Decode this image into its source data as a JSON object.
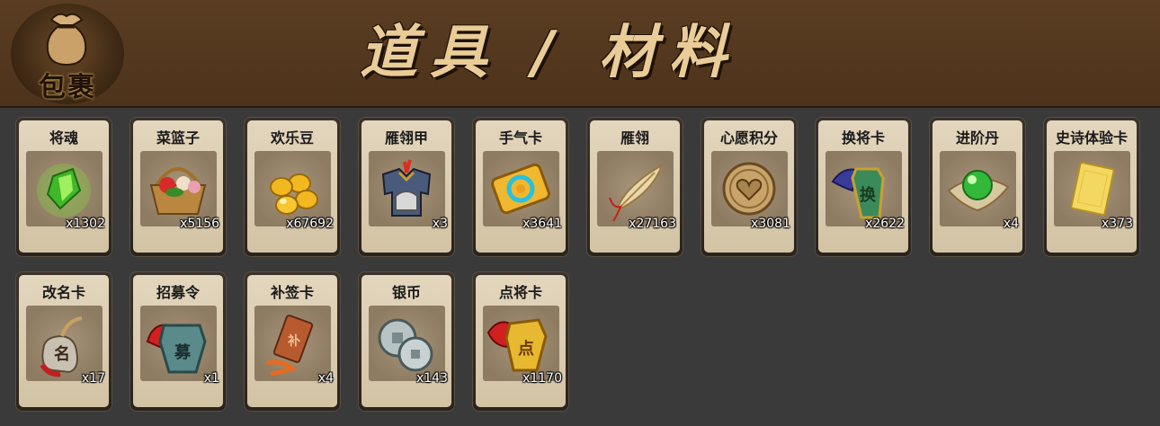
{
  "header": {
    "logo_text": "包裹",
    "title": "道具 / 材料"
  },
  "items": [
    {
      "name": "将魂",
      "qty": "x1302",
      "icon": "green-crystal-icon"
    },
    {
      "name": "菜篮子",
      "qty": "x5156",
      "icon": "flower-basket-icon"
    },
    {
      "name": "欢乐豆",
      "qty": "x67692",
      "icon": "gold-beans-icon"
    },
    {
      "name": "雁翎甲",
      "qty": "x3",
      "icon": "armor-icon"
    },
    {
      "name": "手气卡",
      "qty": "x3641",
      "icon": "luck-card-icon"
    },
    {
      "name": "雁翎",
      "qty": "x27163",
      "icon": "feather-icon"
    },
    {
      "name": "心愿积分",
      "qty": "x3081",
      "icon": "heart-coin-icon"
    },
    {
      "name": "换将卡",
      "qty": "x2622",
      "icon": "swap-general-token-icon"
    },
    {
      "name": "进阶丹",
      "qty": "x4",
      "icon": "green-pill-icon"
    },
    {
      "name": "史诗体验卡",
      "qty": "x373",
      "icon": "epic-trial-card-icon"
    },
    {
      "name": "改名卡",
      "qty": "x17",
      "icon": "rename-tag-icon"
    },
    {
      "name": "招募令",
      "qty": "x1",
      "icon": "recruit-order-icon"
    },
    {
      "name": "补签卡",
      "qty": "x4",
      "icon": "makeup-signin-card-icon"
    },
    {
      "name": "银币",
      "qty": "x143",
      "icon": "silver-coins-icon"
    },
    {
      "name": "点将卡",
      "qty": "x1170",
      "icon": "pick-general-token-icon"
    }
  ]
}
